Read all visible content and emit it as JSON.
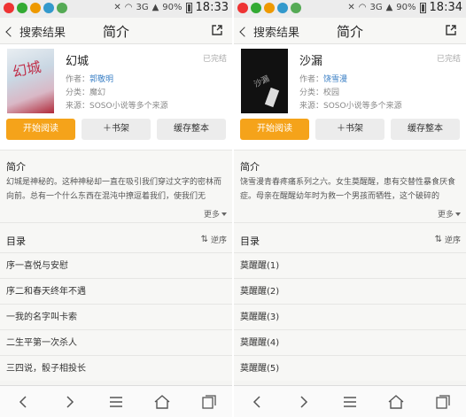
{
  "left": {
    "status": {
      "battery": "90%",
      "time": "18:33",
      "signal": "3G"
    },
    "nav": {
      "back_label": "搜索结果",
      "title": "简介"
    },
    "book": {
      "title": "幻城",
      "status": "已完结",
      "cover_text": "幻城",
      "author_label": "作者：",
      "author": "郭敬明",
      "category": "分类：魔幻",
      "source": "来源：SOSO小说等多个来源"
    },
    "buttons": {
      "read": "开始阅读",
      "shelf": "＋书架",
      "cache": "缓存整本"
    },
    "intro": {
      "heading": "简介",
      "text": "幻城是神秘的。这种神秘却一直在吸引我们穿过文字的密林而向前。总有一个什么东西在混沌中撩逗着我们，使我们无",
      "more": "更多"
    },
    "toc": {
      "heading": "目录",
      "sort_label": "逆序",
      "items": [
        "序一喜悦与安慰",
        "序二和春天终年不遇",
        "一我的名字叫卡索",
        "二生平第一次杀人",
        "三四说，骰子相投长"
      ]
    }
  },
  "right": {
    "status": {
      "battery": "90%",
      "time": "18:34",
      "signal": "3G"
    },
    "nav": {
      "back_label": "搜索结果",
      "title": "简介"
    },
    "book": {
      "title": "沙漏",
      "status": "已完结",
      "cover_text": "沙漏",
      "author_label": "作者：",
      "author": "饶雪漫",
      "category": "分类：校园",
      "source": "来源：SOSO小说等多个来源"
    },
    "buttons": {
      "read": "开始阅读",
      "shelf": "＋书架",
      "cache": "缓存整本"
    },
    "intro": {
      "heading": "简介",
      "text": "饶雪漫青春疼痛系列之六。女生莫醒醒，患有交替性暴食厌食症。母亲在醒醒幼年时为救一个男孩而牺牲，这个破碎的",
      "more": "更多"
    },
    "toc": {
      "heading": "目录",
      "sort_label": "逆序",
      "items": [
        "莫醒醒(1)",
        "莫醒醒(2)",
        "莫醒醒(3)",
        "莫醒醒(4)",
        "莫醒醒(5)"
      ]
    }
  },
  "colors": {
    "accent": "#f5a31a",
    "link": "#3a7fc5"
  },
  "icons": [
    "back-icon",
    "share-icon",
    "sort-icon",
    "more-icon",
    "nav-back-icon",
    "nav-forward-icon",
    "menu-icon",
    "home-icon",
    "tabs-icon"
  ]
}
